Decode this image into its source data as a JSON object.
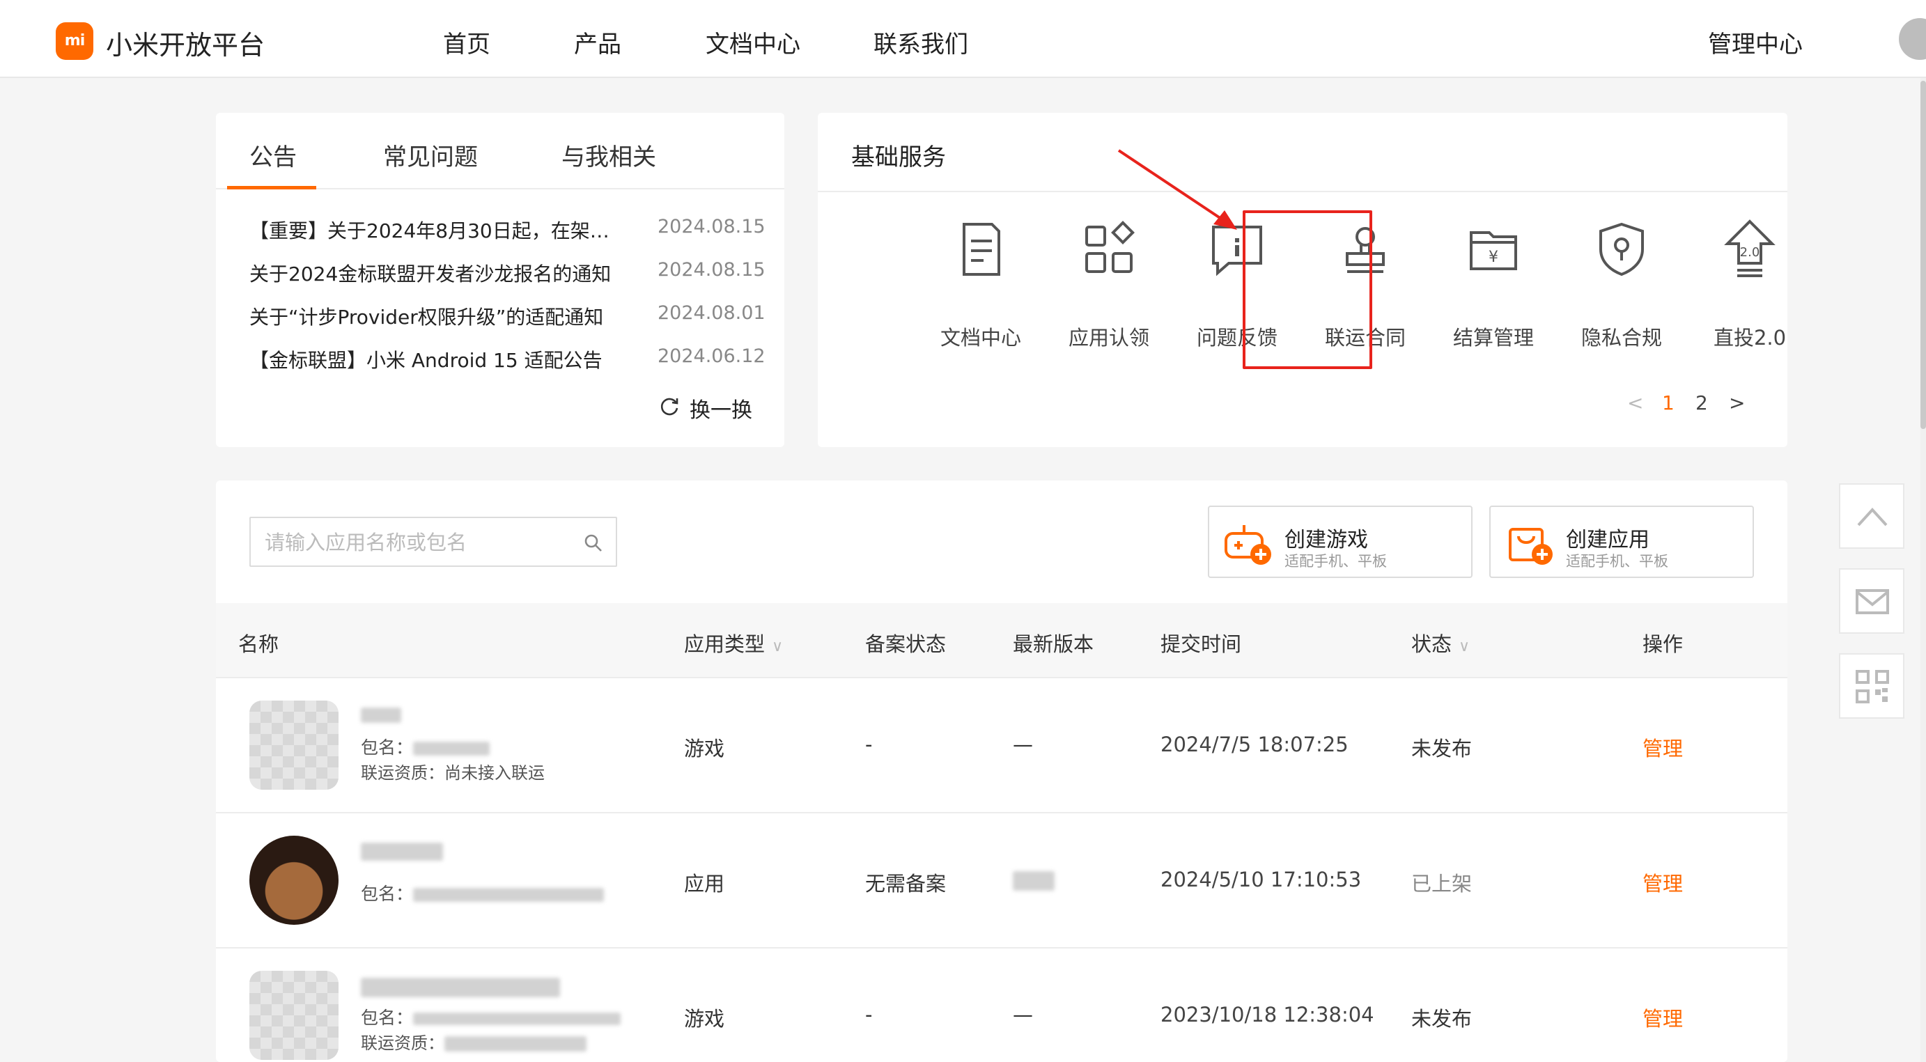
{
  "header": {
    "logo_mark": "mi",
    "logo_text": "小米开放平台",
    "nav": [
      "首页",
      "产品",
      "文档中心",
      "联系我们"
    ],
    "admin_link": "管理中心"
  },
  "notices": {
    "tabs": [
      "公告",
      "常见问题",
      "与我相关"
    ],
    "active_tab": "公告",
    "items": [
      {
        "title": "【重要】关于2024年8月30日起，在架应...",
        "date": "2024.08.15"
      },
      {
        "title": "关于2024金标联盟开发者沙龙报名的通知",
        "date": "2024.08.15"
      },
      {
        "title": "关于“计步Provider权限升级”的适配通知",
        "date": "2024.08.01"
      },
      {
        "title": "【金标联盟】小米 Android 15 适配公告",
        "date": "2024.06.12"
      }
    ],
    "refresh_label": "换一换"
  },
  "services": {
    "title": "基础服务",
    "items": [
      {
        "label": "文档中心",
        "icon": "document-icon"
      },
      {
        "label": "应用认领",
        "icon": "apps-claim-icon"
      },
      {
        "label": "问题反馈",
        "icon": "feedback-icon"
      },
      {
        "label": "联运合同",
        "icon": "seal-stamp-icon"
      },
      {
        "label": "结算管理",
        "icon": "wallet-yuan-icon"
      },
      {
        "label": "隐私合规",
        "icon": "privacy-shield-icon"
      },
      {
        "label": "直投2.0",
        "icon": "upload-2-icon"
      }
    ],
    "highlighted": "联运合同",
    "pages": [
      "1",
      "2"
    ],
    "current_page": "1",
    "prev_symbol": "<",
    "next_symbol": ">",
    "accent_color": "#ff6900",
    "highlight_color": "#e8231c"
  },
  "apps": {
    "search_placeholder": "请输入应用名称或包名",
    "search_value": "",
    "create_game": {
      "title": "创建游戏",
      "subtitle": "适配手机、平板"
    },
    "create_app": {
      "title": "创建应用",
      "subtitle": "适配手机、平板"
    },
    "columns": [
      "名称",
      "应用类型",
      "备案状态",
      "最新版本",
      "提交时间",
      "状态",
      "操作"
    ],
    "rows": [
      {
        "pkg_label": "包名：",
        "qualification": "联运资质：尚未接入联运",
        "type": "游戏",
        "record": "-",
        "version": "—",
        "time": "2024/7/5 18:07:25",
        "status": "未发布",
        "action": "管理"
      },
      {
        "pkg_label": "包名：",
        "qualification": "",
        "type": "应用",
        "record": "无需备案",
        "version": "",
        "time": "2024/5/10 17:10:53",
        "status": "已上架",
        "action": "管理"
      },
      {
        "pkg_label": "包名：",
        "qualification": "联运资质：",
        "type": "游戏",
        "record": "-",
        "version": "—",
        "time": "2023/10/18 12:38:04",
        "status": "未发布",
        "action": "管理"
      }
    ]
  }
}
